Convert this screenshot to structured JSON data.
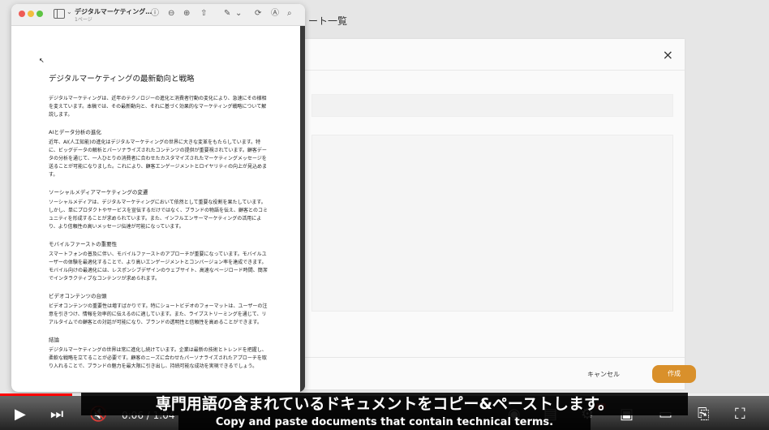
{
  "background_app": {
    "title_fragment": "ート一覧",
    "close_label": "×",
    "cancel_label": "キャンセル",
    "create_label": "作成",
    "accent_color": "#d9902b"
  },
  "preview_window": {
    "title": "デジタルマーケティング…",
    "subtitle": "1ページ",
    "toolbar_icons": [
      "sidebar-icon",
      "info-icon",
      "zoom-out-icon",
      "zoom-in-icon",
      "share-icon",
      "markup-icon",
      "rotate-icon",
      "annotate-icon",
      "search-icon"
    ]
  },
  "document": {
    "title": "デジタルマーケティングの最新動向と戦略",
    "intro": "デジタルマーケティングは、近年のテクノロジーの進化と消費者行動の変化により、急速にその様相を変えています。本稿では、その最新動向と、それに基づく効果的なマーケティング戦略について解説します。",
    "sections": [
      {
        "heading": "AIとデータ分析の進化",
        "body": "近年、AI(人工知能)の進化はデジタルマーケティングの世界に大きな変革をもたらしています。特に、ビッグデータの解析とパーソナライズされたコンテンツの提供が重要視されています。顧客データの分析を通じて、一人ひとりの消費者に合わせたカスタマイズされたマーケティングメッセージを送ることが可能になりました。これにより、顧客エンゲージメントとロイヤリティの向上が見込めます。"
      },
      {
        "heading": "ソーシャルメディアマーケティングの変遷",
        "body": "ソーシャルメディアは、デジタルマーケティングにおいて依然として重要な役割を果たしています。しかし、単にプロダクトやサービスを宣伝するだけではなく、ブランドの物語を伝え、顧客とのコミュニティを形成することが求められています。また、インフルエンサーマーケティングの活用により、より信頼性の高いメッセージ伝達が可能になっています。"
      },
      {
        "heading": "モバイルファーストの重要性",
        "body": "スマートフォンの普及に伴い、モバイルファーストのアプローチが重要になっています。モバイルユーザーの体験を最適化することで、より高いエンゲージメントとコンバージョン率を達成できます。モバイル向けの最適化には、レスポンシブデザインのウェブサイト、高速なページロード時間、簡潔でインタラクティブなコンテンツが求められます。"
      },
      {
        "heading": "ビデオコンテンツの台頭",
        "body": "ビデオコンテンツの重要性は増すばかりです。特にショートビデオのフォーマットは、ユーザーの注意を引きつけ、情報を効率的に伝えるのに適しています。また、ライブストリーミングを通じて、リアルタイムでの顧客との対話が可能になり、ブランドの透明性と信頼性を高めることができます。"
      },
      {
        "heading": "結論",
        "body": "デジタルマーケティングの世界は常に進化し続けています。企業は最新の技術とトレンドを把握し、柔軟な戦略を立てることが必要です。顧客のニーズに合わせたパーソナライズされたアプローチを取り入れることで、ブランドの魅力を最大限に引き出し、持続可能な成功を実現できるでしょう。"
      }
    ]
  },
  "player": {
    "time_display": "0:06 / 1:04",
    "progress_fraction": 0.094,
    "hd_badge": "HD",
    "caption_jp": "専門用語の含まれているドキュメントをコピー&ペーストします。",
    "caption_en": "Copy and paste documents that contain technical terms."
  }
}
